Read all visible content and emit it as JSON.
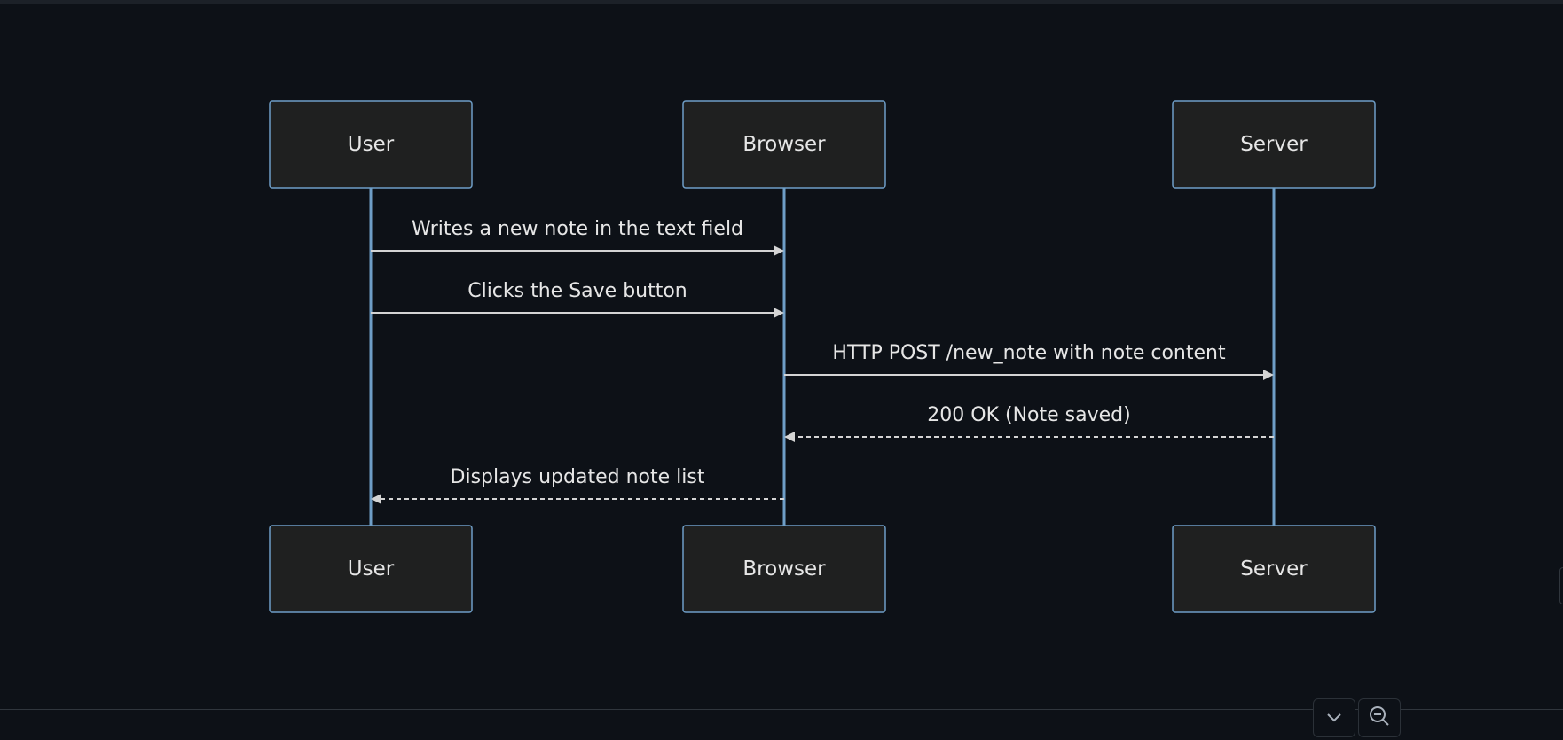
{
  "diagram": {
    "participants": [
      "User",
      "Browser",
      "Server"
    ],
    "messages": [
      {
        "from": "User",
        "to": "Browser",
        "label": "Writes a new note in the text field",
        "style": "solid"
      },
      {
        "from": "User",
        "to": "Browser",
        "label": "Clicks the Save button",
        "style": "solid"
      },
      {
        "from": "Browser",
        "to": "Server",
        "label": "HTTP POST /new_note with note content",
        "style": "solid"
      },
      {
        "from": "Server",
        "to": "Browser",
        "label": "200 OK (Note saved)",
        "style": "dashed"
      },
      {
        "from": "Browser",
        "to": "User",
        "label": "Displays updated note list",
        "style": "dashed"
      }
    ]
  },
  "controls": {
    "collapse_icon": "chevron-down-icon",
    "zoom_out_icon": "zoom-out-icon"
  },
  "colors": {
    "background": "#0d1117",
    "box_fill": "#1f2020",
    "box_stroke": "#6e9ec7",
    "lifeline": "#6e9ec7",
    "arrow": "#d4d4d4",
    "text": "#e6e6e6"
  }
}
